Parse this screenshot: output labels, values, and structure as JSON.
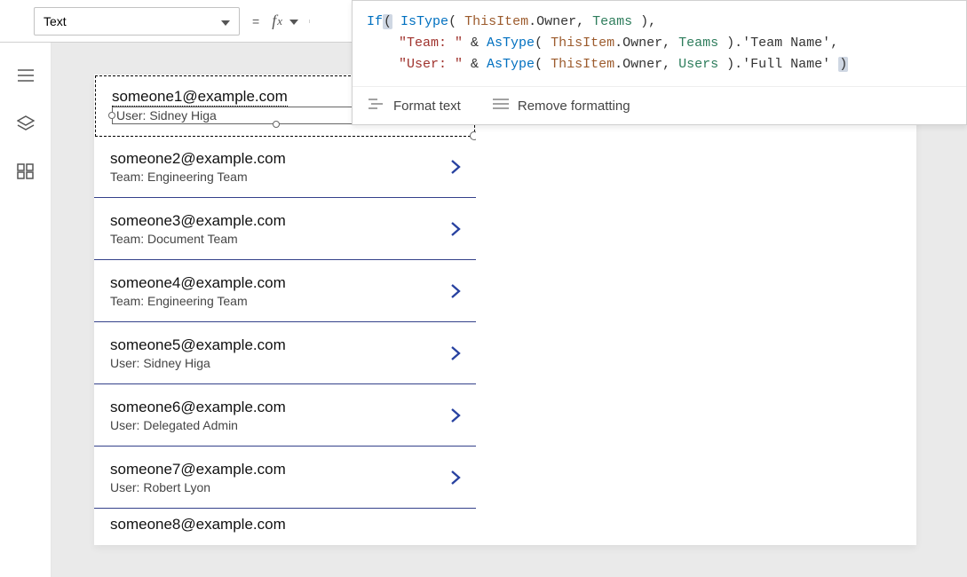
{
  "header": {
    "property": "Text",
    "equals": "=",
    "fx": "fx"
  },
  "formula": {
    "summary_line": "If( IsType( ThisItem.Owner, Teams ),",
    "tokens": [
      [
        "kw",
        "If"
      ],
      [
        "hlparen",
        "("
      ],
      [
        "op",
        " "
      ],
      [
        "kw",
        "IsType"
      ],
      [
        "op",
        "( "
      ],
      [
        "objkw",
        "ThisItem"
      ],
      [
        "op",
        "."
      ],
      [
        "prop",
        "Owner"
      ],
      [
        "op",
        ", "
      ],
      [
        "enum",
        "Teams"
      ],
      [
        "op",
        " ),"
      ],
      [
        "br",
        ""
      ],
      [
        "indent",
        "    "
      ],
      [
        "str",
        "\"Team: \""
      ],
      [
        "op",
        " & "
      ],
      [
        "kw",
        "AsType"
      ],
      [
        "op",
        "( "
      ],
      [
        "objkw",
        "ThisItem"
      ],
      [
        "op",
        "."
      ],
      [
        "prop",
        "Owner"
      ],
      [
        "op",
        ", "
      ],
      [
        "enum",
        "Teams"
      ],
      [
        "op",
        " )."
      ],
      [
        "prop",
        "'Team Name'"
      ],
      [
        "op",
        ","
      ],
      [
        "br",
        ""
      ],
      [
        "indent",
        "    "
      ],
      [
        "str",
        "\"User: \""
      ],
      [
        "op",
        " & "
      ],
      [
        "kw",
        "AsType"
      ],
      [
        "op",
        "( "
      ],
      [
        "objkw",
        "ThisItem"
      ],
      [
        "op",
        "."
      ],
      [
        "prop",
        "Owner"
      ],
      [
        "op",
        ", "
      ],
      [
        "enum",
        "Users"
      ],
      [
        "op",
        " )."
      ],
      [
        "prop",
        "'Full Name'"
      ],
      [
        "op",
        " "
      ],
      [
        "hlparen",
        ")"
      ]
    ]
  },
  "format_bar": {
    "format_text": "Format text",
    "remove_formatting": "Remove formatting"
  },
  "gallery": {
    "selected": {
      "title": "someone1@example.com",
      "subtitle": "User: Sidney Higa"
    },
    "rows": [
      {
        "title": "someone2@example.com",
        "subtitle": "Team: Engineering Team"
      },
      {
        "title": "someone3@example.com",
        "subtitle": "Team: Document Team"
      },
      {
        "title": "someone4@example.com",
        "subtitle": "Team: Engineering Team"
      },
      {
        "title": "someone5@example.com",
        "subtitle": "User: Sidney Higa"
      },
      {
        "title": "someone6@example.com",
        "subtitle": "User: Delegated Admin"
      },
      {
        "title": "someone7@example.com",
        "subtitle": "User: Robert Lyon"
      }
    ],
    "partial": {
      "title": "someone8@example.com"
    }
  },
  "rail_icons": [
    "hamburger-icon",
    "layers-icon",
    "components-icon"
  ]
}
